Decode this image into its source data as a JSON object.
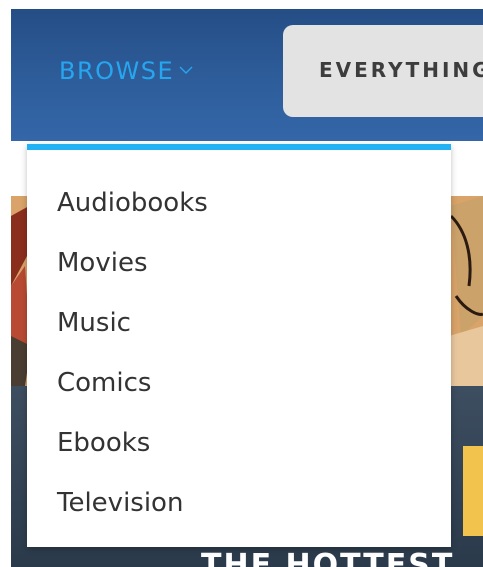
{
  "header": {
    "browse_label": "BROWSE",
    "browse_icon": "chevron-down-icon",
    "search_scope_label": "EVERYTHING",
    "accent_color": "#27a6f0",
    "header_color": "#2d5c99"
  },
  "dropdown": {
    "accent_color": "#22b1f2",
    "items": [
      {
        "label": "Audiobooks"
      },
      {
        "label": "Movies"
      },
      {
        "label": "Music"
      },
      {
        "label": "Comics"
      },
      {
        "label": "Ebooks"
      },
      {
        "label": "Television"
      }
    ]
  },
  "banner": {
    "tagline": "THE HOTTEST"
  }
}
